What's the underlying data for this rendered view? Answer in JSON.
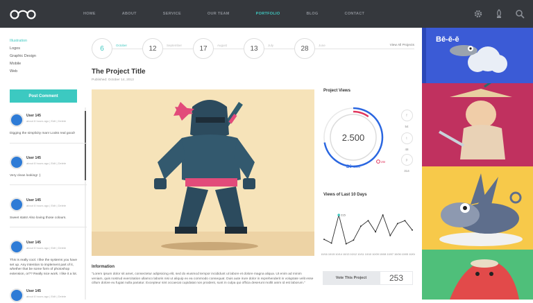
{
  "nav": {
    "items": [
      "HOME",
      "ABOUT",
      "SERVICE",
      "OUR TEAM",
      "PORTFOLIO",
      "BLOG",
      "CONTACT"
    ],
    "active_index": 4
  },
  "header_icons": [
    "gear-icon",
    "lock-icon",
    "search-icon"
  ],
  "sidebar": {
    "categories": [
      "Illustration",
      "Logos",
      "Graphic Design",
      "Mobile",
      "Web"
    ],
    "active_category": 0,
    "post_button": "Post Comment",
    "comments": [
      {
        "user": "User 145",
        "meta": "about 8 hours ago | Edit | Delete",
        "text": "Digging the simplicity man! Looks real good!"
      },
      {
        "user": "User 145",
        "meta": "about 8 hours ago | Edit | Delete",
        "text": "Very clean looking! :)"
      },
      {
        "user": "User 145",
        "meta": "about 8 hours ago | Edit | Delete",
        "text": "Sweet stats! Also loving those colours."
      },
      {
        "user": "User 145",
        "meta": "about 8 hours ago | Edit | Delete",
        "text": "This is really cool. I like the systems you have set up. Any intention to implement part of it, whether that be some form of photoshop extension, or?? Really nice work. I like it a lot."
      },
      {
        "user": "User 145",
        "meta": "about 8 hours ago | Edit | Delete",
        "text": ""
      }
    ]
  },
  "timeline": {
    "days": [
      {
        "day": "6",
        "month": "October"
      },
      {
        "day": "12",
        "month": "September"
      },
      {
        "day": "17",
        "month": "August"
      },
      {
        "day": "13",
        "month": "July"
      },
      {
        "day": "28",
        "month": "June"
      }
    ],
    "active_index": 0,
    "view_all": "View All Projects"
  },
  "project": {
    "title": "The Project Title",
    "published": "Published: October 14, 2013",
    "info_heading": "Information",
    "info_text": "\"Lorem ipsum dolor sit amet, consectetur adipisicing elit, sed do eiusmod tempor incididunt ut labore et dolore magna aliqua. Ut enim ad minim veniam, quis nostrud exercitation ullamco laboris nisi ut aliquip ex ea commodo consequat. Duis aute irure dolor in reprehenderit in voluptate velit esse cillum dolore eu fugiat nulla pariatur. Excepteur sint occaecat cupidatat non proident, sunt in culpa qui officia deserunt mollit anim id est laborum.\""
  },
  "stats": {
    "views_heading": "Project Views",
    "total": "2.500",
    "behance_label": "Bē",
    "behance_value": "1800",
    "dribbble_value": "250",
    "behance_fraction": 0.72,
    "dribbble_fraction": 0.1,
    "social": [
      {
        "icon": "facebook-icon",
        "glyph": "f",
        "count": "54"
      },
      {
        "icon": "twitter-icon",
        "glyph": "t",
        "count": "48"
      },
      {
        "icon": "pinterest-icon",
        "glyph": "p",
        "count": "314"
      }
    ],
    "views10_heading": "Views of Last 10 Days",
    "peak_label": "215",
    "vote_button": "Vote This Project",
    "vote_count": "253"
  },
  "chart_data": {
    "type": "line",
    "categories": [
      "10/16",
      "10/15",
      "10/14",
      "10/13",
      "10/12",
      "10/11",
      "10/10",
      "10/09",
      "10/08",
      "10/07",
      "10/06",
      "10/05",
      "10/04"
    ],
    "values": [
      20,
      10,
      85,
      8,
      18,
      55,
      70,
      40,
      85,
      30,
      62,
      70,
      45
    ],
    "annotation": {
      "index": 2,
      "label": "215"
    },
    "color": "#2a2a2a",
    "accent": "#3fc8c0"
  },
  "colors": {
    "accent": "#3fc8c0",
    "topbar": "#35383d",
    "gauge_blue": "#2a66e0",
    "gauge_pink": "#e0355d"
  },
  "right_panels": [
    "#3b5bd6",
    "#c0315f",
    "#f7c94a",
    "#4fbf7a"
  ],
  "right_panel_speech": "Bē-ē-ē"
}
